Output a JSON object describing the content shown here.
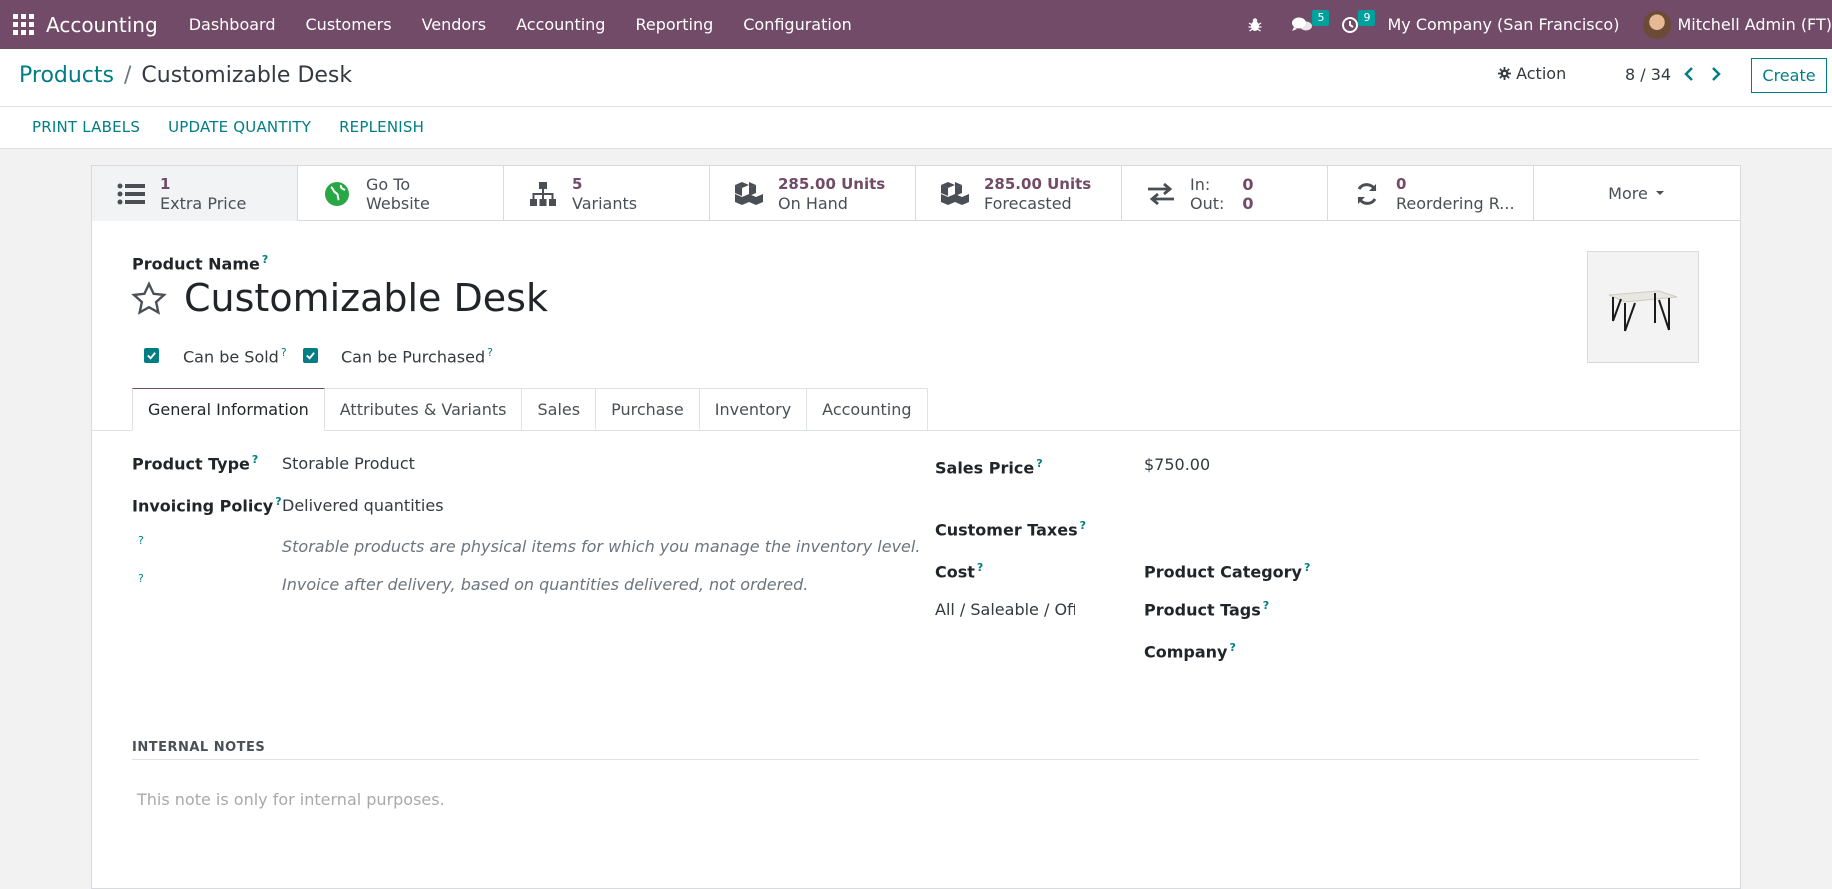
{
  "topbar": {
    "app_name": "Accounting",
    "menu": [
      "Dashboard",
      "Customers",
      "Vendors",
      "Accounting",
      "Reporting",
      "Configuration"
    ],
    "messages_count": "5",
    "activities_count": "9",
    "company": "My Company (San Francisco)",
    "user": "Mitchell Admin (FT)",
    "accent_color": "#714b67"
  },
  "controlpanel": {
    "breadcrumb_parent": "Products",
    "breadcrumb_sep": "/",
    "breadcrumb_current": "Customizable Desk",
    "action_label": "Action",
    "pager": "8 / 34",
    "create_label": "Create",
    "status_buttons": [
      "PRINT LABELS",
      "UPDATE QUANTITY",
      "REPLENISH"
    ]
  },
  "smart_buttons": {
    "extra_price": {
      "value": "1",
      "label": "Extra Price"
    },
    "website": {
      "line1": "Go To",
      "line2": "Website"
    },
    "variants": {
      "value": "5",
      "label": "Variants"
    },
    "on_hand": {
      "value": "285.00 Units",
      "label": "On Hand"
    },
    "forecasted": {
      "value": "285.00 Units",
      "label": "Forecasted"
    },
    "in_out": {
      "in_label": "In:",
      "in_value": "0",
      "out_label": "Out:",
      "out_value": "0"
    },
    "reordering": {
      "value": "0",
      "label": "Reordering R..."
    },
    "more_label": "More"
  },
  "form": {
    "product_name_label": "Product Name",
    "product_name": "Customizable Desk",
    "can_be_sold": "Can be Sold",
    "can_be_purchased": "Can be Purchased",
    "qmark": "?",
    "tabs": [
      "General Information",
      "Attributes & Variants",
      "Sales",
      "Purchase",
      "Inventory",
      "Accounting"
    ],
    "product_type_label": "Product Type",
    "product_type": "Storable Product",
    "invoicing_policy_label": "Invoicing Policy",
    "invoicing_policy": "Delivered quantities",
    "help_type": "Storable products are physical items for which you manage the inventory level.",
    "help_invoice": "Invoice after delivery, based on quantities delivered, not ordered.",
    "sales_price_label": "Sales Price",
    "sales_price": "$750.00",
    "customer_taxes_label": "Customer Taxes",
    "cost_label": "Cost",
    "category_value": "All / Saleable / Offi",
    "product_category_label": "Product Category",
    "product_tags_label": "Product Tags",
    "company_label": "Company",
    "internal_notes_title": "INTERNAL NOTES",
    "internal_notes_placeholder": "This note is only for internal purposes."
  }
}
